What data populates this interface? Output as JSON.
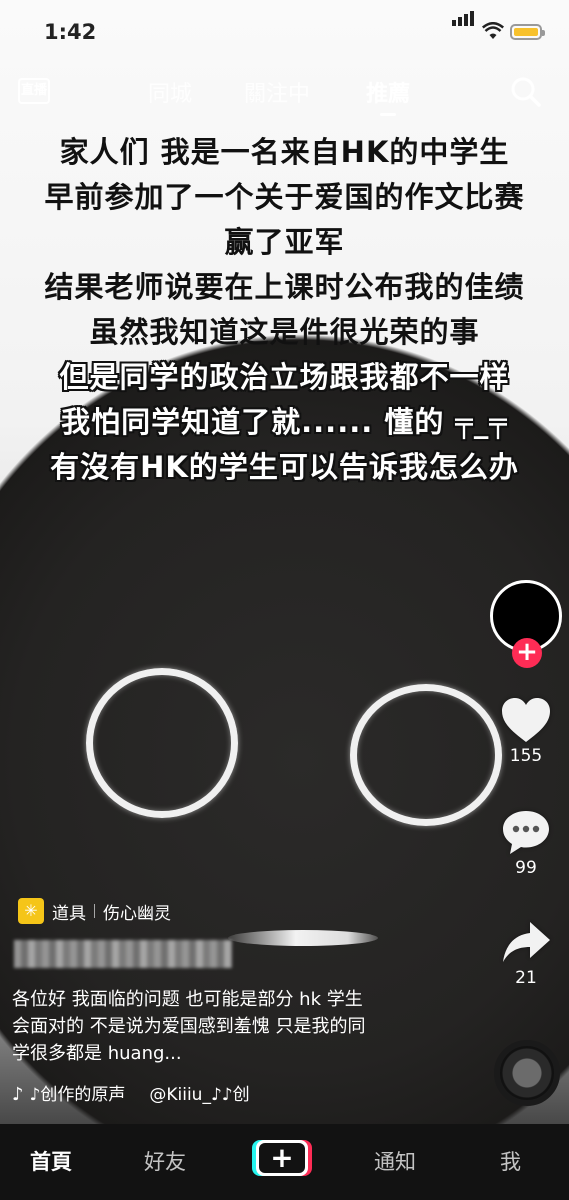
{
  "status_bar": {
    "time": "1:42"
  },
  "top_nav": {
    "live_label": "直播",
    "tabs": [
      {
        "label": "同城",
        "active": false
      },
      {
        "label": "關注中",
        "active": false
      },
      {
        "label": "推薦",
        "active": true
      }
    ],
    "search_icon": "search-icon"
  },
  "overlay_text": [
    "家人们 我是一名来自HK的中学生",
    "早前参加了一个关于爱国的作文比赛",
    "赢了亚军",
    "结果老师说要在上课时公布我的佳绩",
    "虽然我知道这是件很光荣的事",
    "但是同学的政治立场跟我都不一样",
    "我怕同学知道了就...... 懂的 ╤_╤",
    "有沒有HK的学生可以告诉我怎么办"
  ],
  "actions": {
    "likes": "155",
    "comments": "99",
    "shares": "21"
  },
  "prop": {
    "label": "道具",
    "name": "伤心幽灵"
  },
  "description": [
    "各位好 我面临的问题 也可能是部分 hk 学生",
    "会面对的 不是说为爱国感到羞愧 只是我的同",
    "学很多都是 huang..."
  ],
  "music": {
    "text": "♪创作的原声",
    "handle": "@Kiiiu_♪♪创"
  },
  "bottom_nav": {
    "home": "首頁",
    "friends": "好友",
    "create": "+",
    "inbox": "通知",
    "me": "我"
  },
  "colors": {
    "accent": "#fe2c55",
    "cyan": "#25f4ee",
    "nav_bg": "#121212"
  }
}
